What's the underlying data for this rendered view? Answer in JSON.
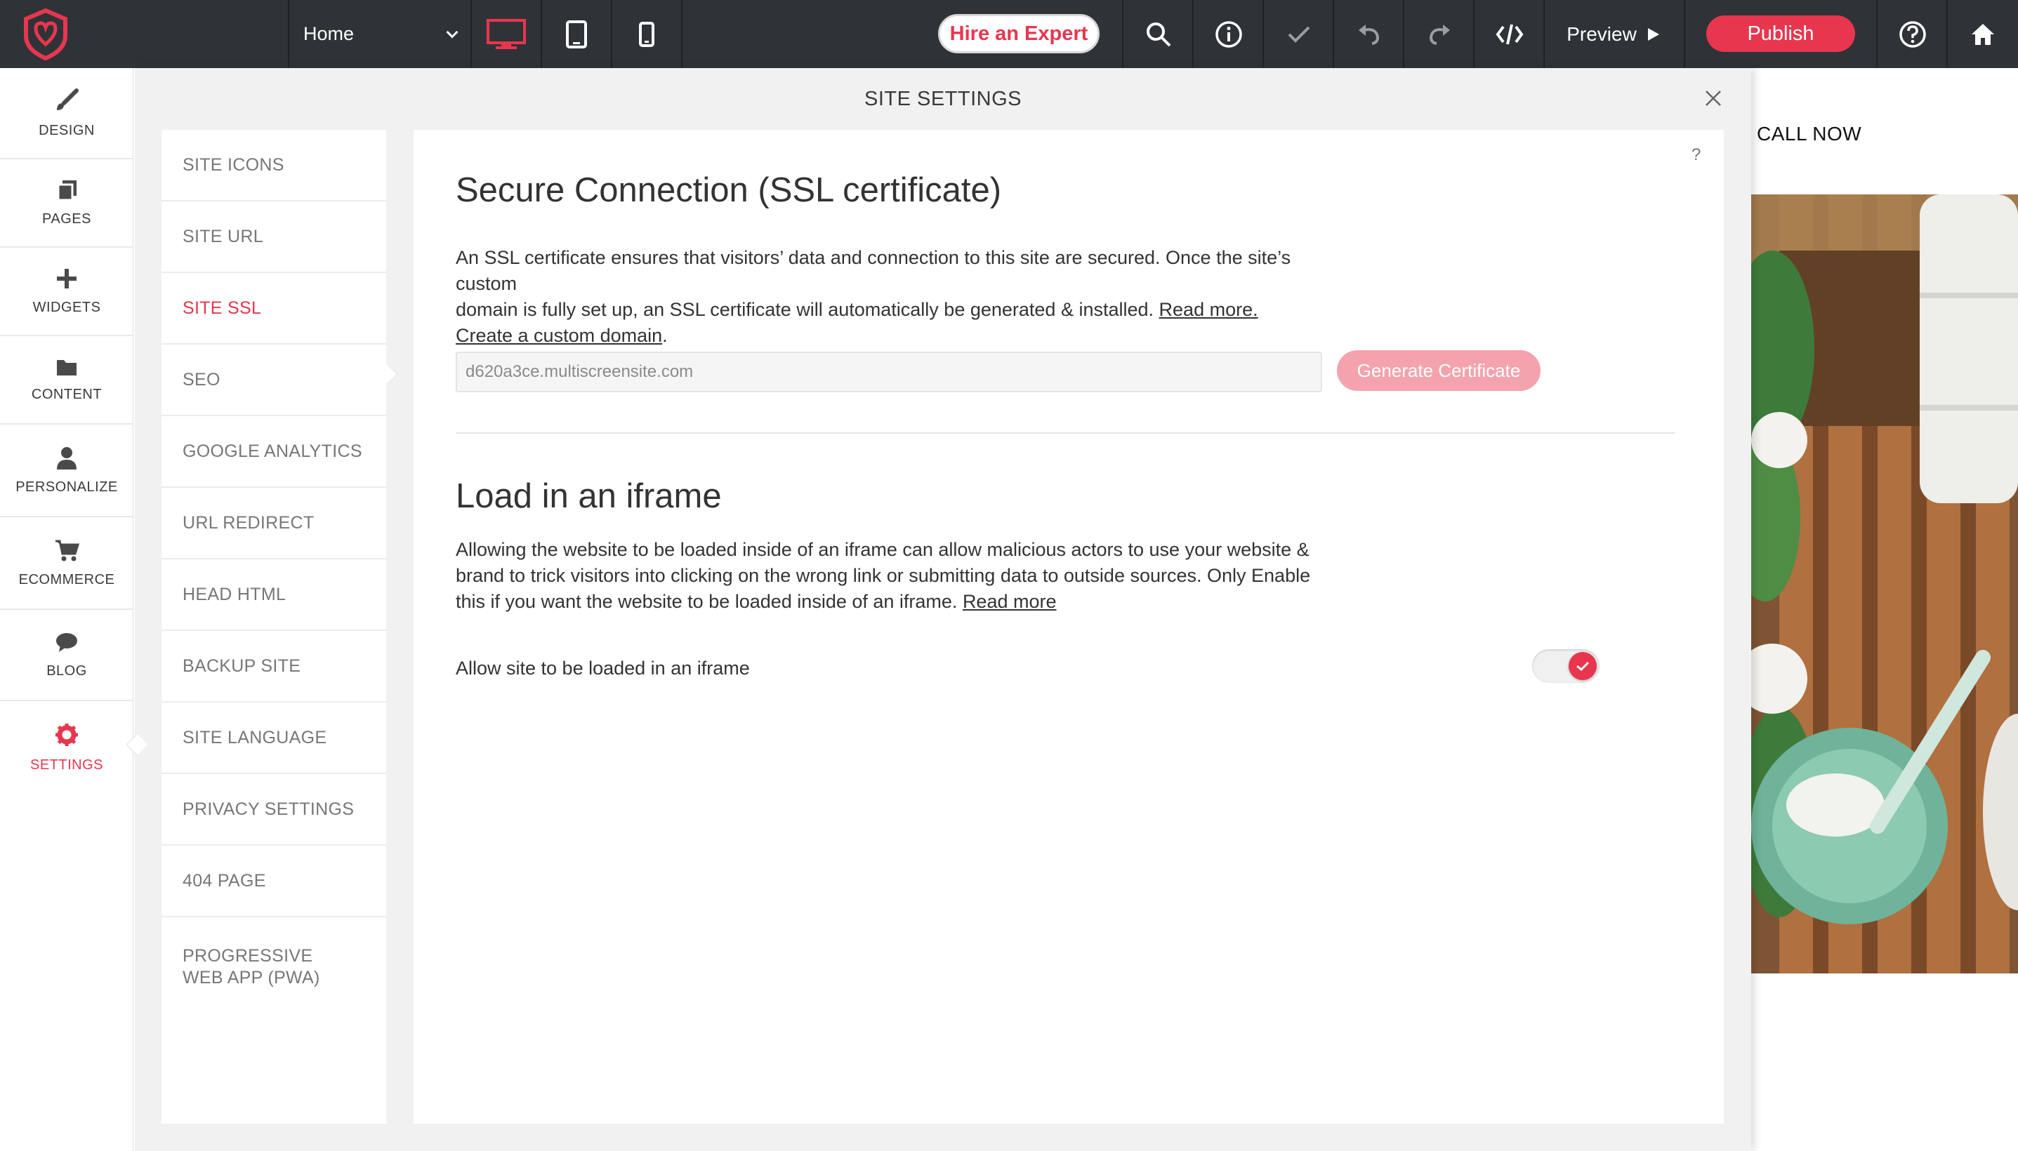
{
  "topbar": {
    "page_select_value": "Home",
    "hire_label": "Hire an Expert",
    "preview_label": "Preview",
    "publish_label": "Publish"
  },
  "sidebar": {
    "items": [
      {
        "label": "DESIGN",
        "icon": "brush-icon"
      },
      {
        "label": "PAGES",
        "icon": "pages-icon"
      },
      {
        "label": "WIDGETS",
        "icon": "plus-icon"
      },
      {
        "label": "CONTENT",
        "icon": "folder-icon"
      },
      {
        "label": "PERSONALIZE",
        "icon": "person-icon"
      },
      {
        "label": "ECOMMERCE",
        "icon": "cart-icon"
      },
      {
        "label": "BLOG",
        "icon": "chat-bubble-icon"
      },
      {
        "label": "SETTINGS",
        "icon": "gear-icon"
      }
    ]
  },
  "modal": {
    "title": "SITE SETTINGS",
    "help": "?",
    "nav": [
      "SITE ICONS",
      "SITE URL",
      "SITE SSL",
      "SEO",
      "GOOGLE ANALYTICS",
      "URL REDIRECT",
      "HEAD HTML",
      "BACKUP SITE",
      "SITE LANGUAGE",
      "PRIVACY SETTINGS",
      "404 PAGE",
      "PROGRESSIVE WEB APP (PWA)"
    ],
    "ssl": {
      "title": "Secure Connection (SSL certificate)",
      "desc_line1": "An SSL certificate ensures that visitors’ data and connection to this site are secured. Once the site’s custom",
      "desc_line2": "domain is fully set up, an SSL certificate will automatically be generated & installed.",
      "read_more": "Read more.",
      "create_domain": "Create a custom domain",
      "period": ".",
      "domain_value": "d620a3ce.multiscreensite.com",
      "generate_label": "Generate Certificate"
    },
    "iframe": {
      "title": "Load in an iframe",
      "desc_line1": "Allowing the website to be loaded inside of an iframe can allow malicious actors to use your website &",
      "desc_line2": "brand to trick visitors into clicking on the wrong link or submitting data to outside sources. Only Enable",
      "desc_line3": "this if you want the website to be loaded inside of an iframe.",
      "read_more": "Read more",
      "toggle_label": "Allow site to be loaded in an iframe",
      "toggle_on": true
    }
  },
  "site_preview": {
    "call_now": "CALL NOW"
  },
  "colors": {
    "accent": "#e8364f",
    "topbar_bg": "#2f3337",
    "link_blue": "#1a73c8"
  }
}
